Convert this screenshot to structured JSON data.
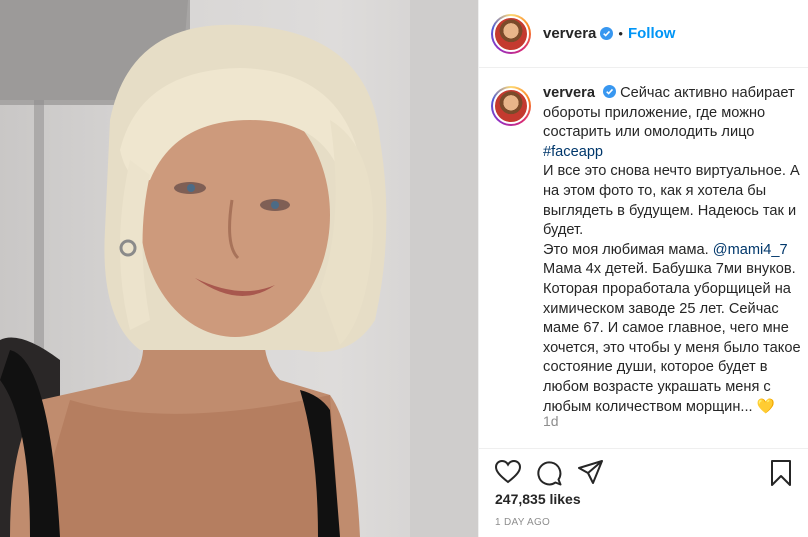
{
  "post": {
    "author": {
      "username": "ververa",
      "verified": true,
      "avatar_icon": "profile-avatar-icon"
    },
    "header": {
      "separator": "•",
      "follow_label": "Follow"
    },
    "caption": {
      "username": "ververa",
      "lines": [
        "Сейчас активно набирает",
        "обороты приложение, где можно",
        "состарить или омолодить лицо"
      ],
      "hashtag": "#faceapp",
      "body_lines": [
        "И все это снова нечто виртуальное. А",
        "на этом фото то, как я хотела бы",
        "выглядеть в будущем. Надеюсь так и",
        "будет."
      ],
      "mention_prefix": "Это моя любимая мама. ",
      "mention": "@mami4_7",
      "tail_lines": [
        "Мама 4х детей. Бабушка 7ми внуков.",
        "Которая проработала уборщицей на",
        "химическом заводе 25 лет. Сейчас",
        "маме 67. И самое главное, чего мне",
        "хочется, это чтобы у меня было такое",
        "состояние души, которое будет в",
        "любом возрасте украшать меня с",
        "любым количеством морщин... "
      ],
      "emoji": "💛",
      "time_ago": "1d"
    },
    "likes": "247,835 likes",
    "date": "1 DAY AGO",
    "icons": [
      "heart-icon",
      "comment-icon",
      "share-icon",
      "bookmark-icon"
    ],
    "colors": {
      "accent": "#0095f6",
      "link": "#00376b",
      "text": "#262626",
      "muted": "#8e8e8e",
      "border": "#efefef"
    }
  }
}
